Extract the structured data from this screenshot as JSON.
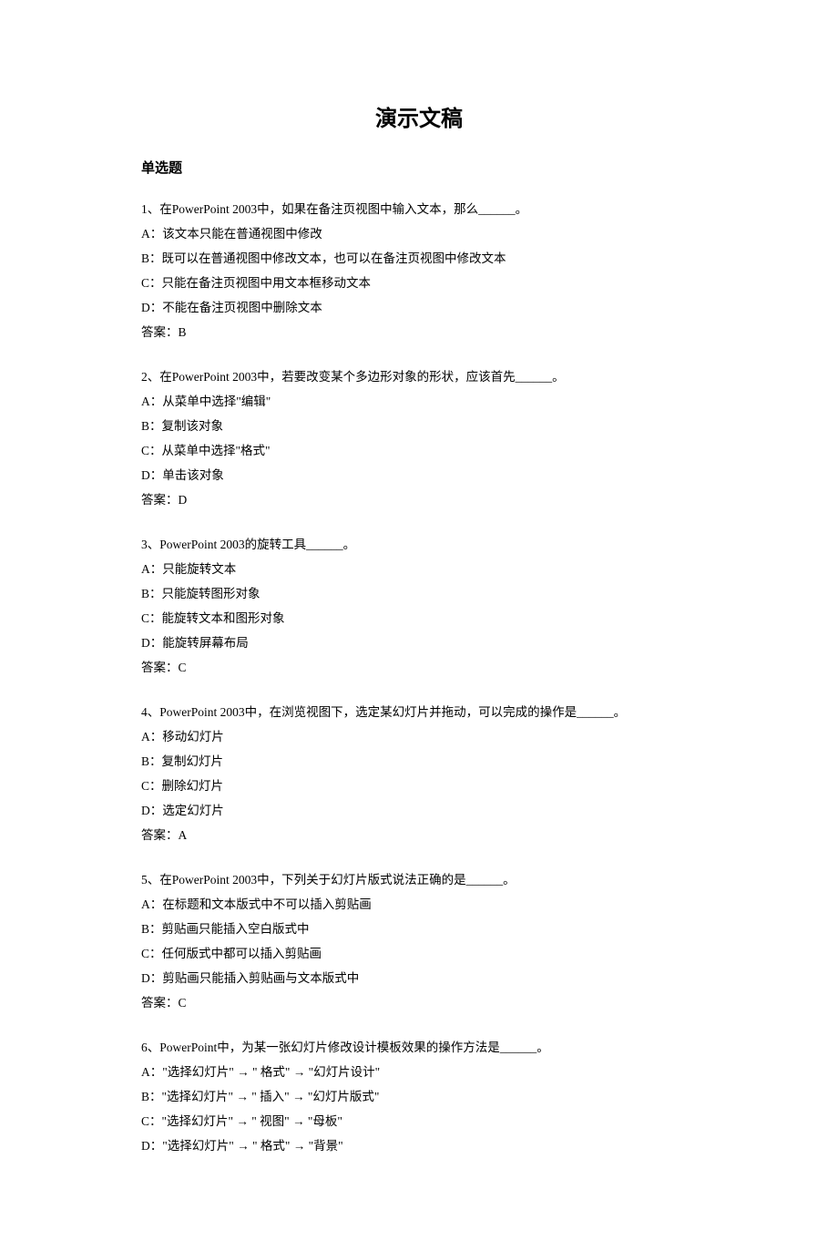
{
  "title": "演示文稿",
  "section": "单选题",
  "questions": [
    {
      "stem": "1、在PowerPoint 2003中，如果在备注页视图中输入文本，那么______。",
      "options": [
        "A：该文本只能在普通视图中修改",
        "B：既可以在普通视图中修改文本，也可以在备注页视图中修改文本",
        "C：只能在备注页视图中用文本框移动文本",
        "D：不能在备注页视图中删除文本"
      ],
      "answer": "答案：B"
    },
    {
      "stem": "2、在PowerPoint 2003中，若要改变某个多边形对象的形状，应该首先______。",
      "options": [
        "A：从菜单中选择\"编辑\"",
        "B：复制该对象",
        "C：从菜单中选择\"格式\"",
        "D：单击该对象"
      ],
      "answer": "答案：D"
    },
    {
      "stem": "3、PowerPoint 2003的旋转工具______。",
      "options": [
        "A：只能旋转文本",
        "B：只能旋转图形对象",
        "C：能旋转文本和图形对象",
        "D：能旋转屏幕布局"
      ],
      "answer": "答案：C"
    },
    {
      "stem": "4、PowerPoint 2003中，在浏览视图下，选定某幻灯片并拖动，可以完成的操作是______。",
      "options": [
        "A：移动幻灯片",
        "B：复制幻灯片",
        "C：删除幻灯片",
        "D：选定幻灯片"
      ],
      "answer": "答案：A"
    },
    {
      "stem": "5、在PowerPoint 2003中，下列关于幻灯片版式说法正确的是______。",
      "options": [
        "A：在标题和文本版式中不可以插入剪贴画",
        "B：剪贴画只能插入空白版式中",
        "C：任何版式中都可以插入剪贴画",
        "D：剪贴画只能插入剪贴画与文本版式中"
      ],
      "answer": "答案：C"
    },
    {
      "stem": "6、PowerPoint中，为某一张幻灯片修改设计模板效果的操作方法是______。",
      "options": [
        "A：\"选择幻灯片\" → \" 格式\" → \"幻灯片设计\"",
        "B：\"选择幻灯片\" → \" 插入\" → \"幻灯片版式\"",
        "C：\"选择幻灯片\" → \" 视图\" → \"母板\"",
        "D：\"选择幻灯片\" → \" 格式\" → \"背景\""
      ],
      "answer": ""
    }
  ]
}
